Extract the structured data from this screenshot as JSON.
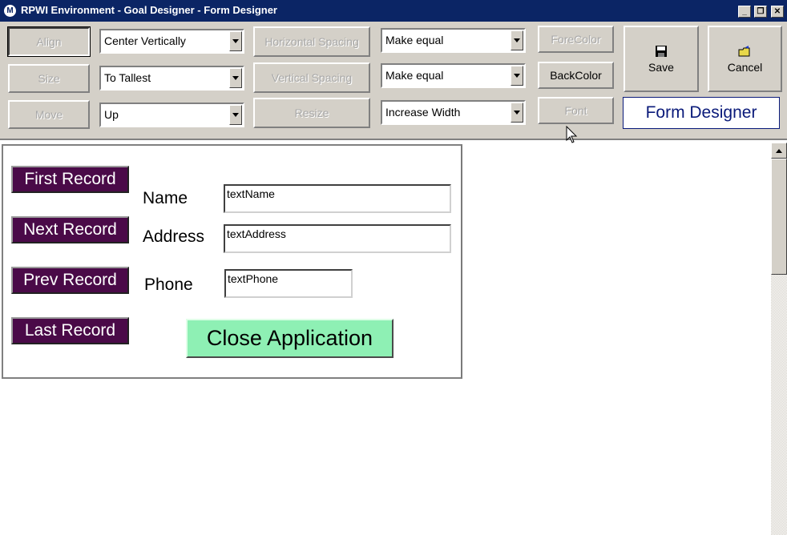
{
  "window": {
    "title": "RPWI Environment - Goal Designer - Form Designer",
    "logo_letter": "M",
    "controls": {
      "minimize": "_",
      "restore": "❐",
      "close": "✕"
    }
  },
  "toolbar": {
    "align": {
      "label": "Align",
      "option": "Center Vertically"
    },
    "size": {
      "label": "Size",
      "option": "To Tallest"
    },
    "move": {
      "label": "Move",
      "option": "Up"
    },
    "horizontal_spacing": {
      "label": "Horizontal Spacing",
      "option": "Make equal"
    },
    "vertical_spacing": {
      "label": "Vertical Spacing",
      "option": "Make equal"
    },
    "resize": {
      "label": "Resize",
      "option": "Increase Width"
    },
    "forecolor_label": "ForeColor",
    "backcolor_label": "BackColor",
    "font_label": "Font",
    "save_label": "Save",
    "cancel_label": "Cancel",
    "designer_title": "Form Designer"
  },
  "form": {
    "buttons": {
      "first": "First Record",
      "next": "Next Record",
      "prev": "Prev Record",
      "last": "Last Record",
      "close": "Close Application"
    },
    "labels": {
      "name": "Name",
      "address": "Address",
      "phone": "Phone"
    },
    "fields": {
      "name": "textName",
      "address": "textAddress",
      "phone": "textPhone"
    }
  },
  "colors": {
    "title_bar": "#0b2565",
    "record_button": "#4a0a48",
    "close_button": "#8ef0b4",
    "designer_title_text": "#0a1a7a"
  }
}
